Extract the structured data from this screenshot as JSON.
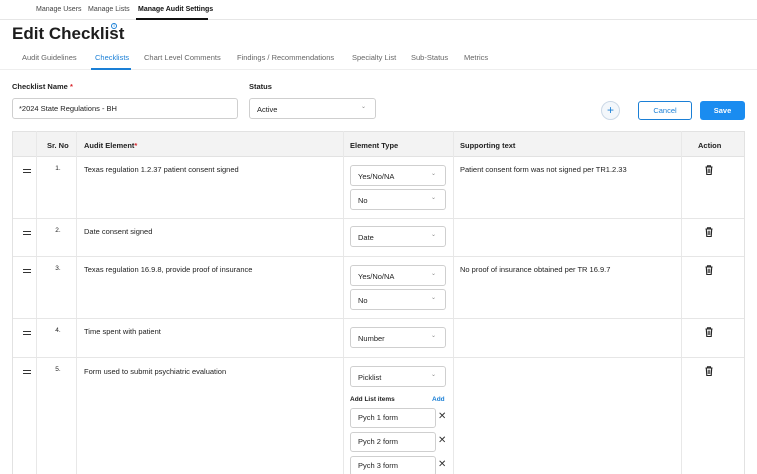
{
  "top_nav": {
    "items": [
      "Manage Users",
      "Manage Lists",
      "Manage Audit Settings"
    ],
    "active_index": 2
  },
  "page": {
    "title": "Edit Checklist",
    "info_badge": "i"
  },
  "tabs": [
    "Audit Guidelines",
    "Checklists",
    "Chart Level Comments",
    "Findings / Recommendations",
    "Specialty List",
    "Sub-Status",
    "Metrics"
  ],
  "active_tab": "Checklists",
  "form": {
    "checklist_name_label": "Checklist Name",
    "required_mark": "*",
    "checklist_name_value": "*2024 State Regulations - BH",
    "status_label": "Status",
    "status_value": "Active"
  },
  "actions": {
    "add_label": "+",
    "cancel_label": "Cancel",
    "save_label": "Save"
  },
  "table": {
    "headers": {
      "srno": "Sr. No",
      "element": "Audit Element",
      "type": "Element Type",
      "supporting": "Supporting text",
      "action": "Action"
    },
    "rows": [
      {
        "sr": "1.",
        "element": "Texas regulation 1.2.37 patient consent signed",
        "type": "Yes/No/NA",
        "subtype": "No",
        "supporting": "Patient consent form was not signed per TR1.2.33"
      },
      {
        "sr": "2.",
        "element": "Date consent signed",
        "type": "Date",
        "subtype": "",
        "supporting": ""
      },
      {
        "sr": "3.",
        "element": "Texas regulation 16.9.8, provide proof of insurance",
        "type": "Yes/No/NA",
        "subtype": "No",
        "supporting": "No proof of insurance obtained per TR 16.9.7"
      },
      {
        "sr": "4.",
        "element": "Time spent with patient",
        "type": "Number",
        "subtype": "",
        "supporting": ""
      },
      {
        "sr": "5.",
        "element": "Form used to submit psychiatric evaluation",
        "type": "Picklist",
        "subtype": "",
        "supporting": "",
        "add_list_label": "Add List items",
        "add_link": "Add",
        "list_items": [
          "Pych 1 form",
          "Pych 2 form",
          "Pych 3 form"
        ]
      }
    ]
  },
  "colors": {
    "accent": "#1a8cf0",
    "link": "#1a7fd6",
    "required": "#d9262c",
    "header_bg": "#f3f3f3"
  },
  "icons": {
    "drag": "drag-handle-icon",
    "delete": "trash-icon",
    "remove": "close-icon",
    "dropdown": "chevron-down-icon",
    "add": "plus-icon"
  }
}
